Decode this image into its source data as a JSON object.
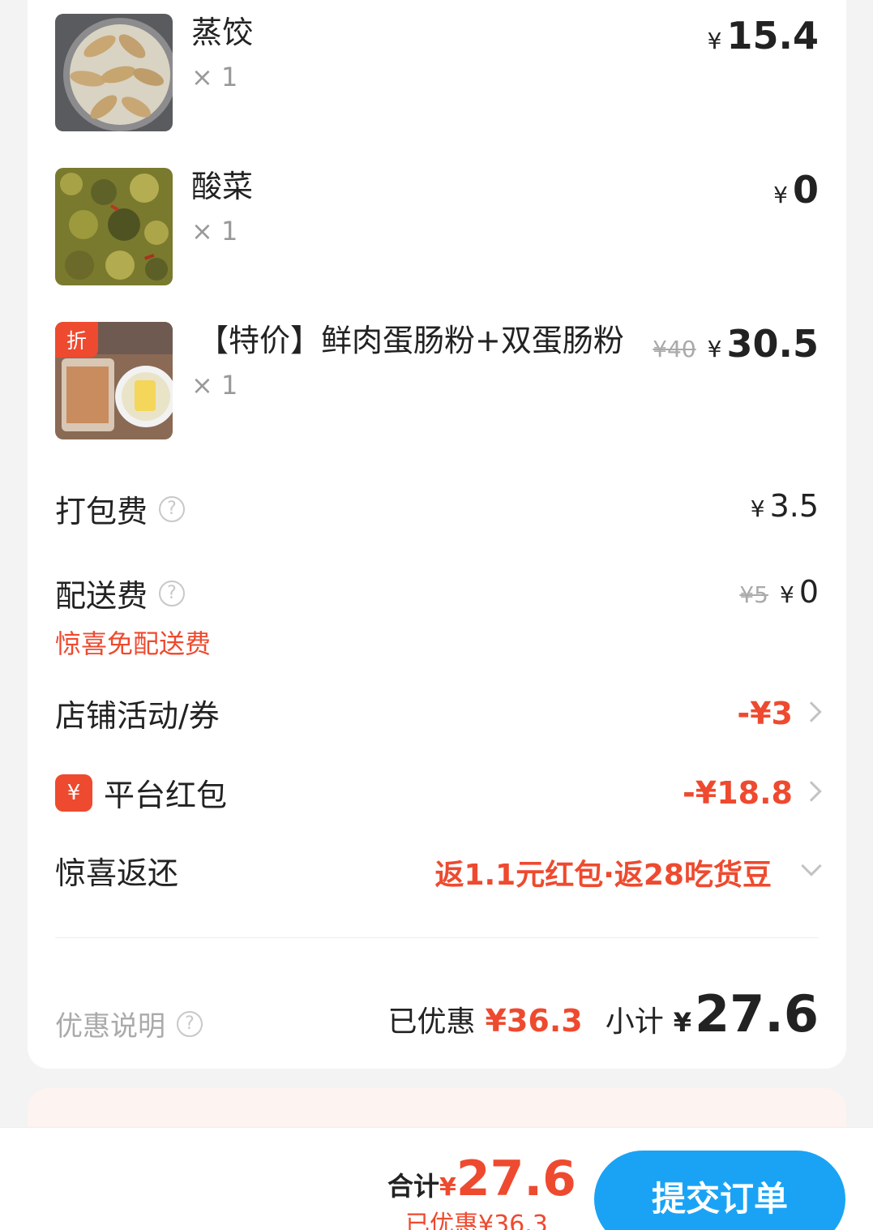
{
  "items": [
    {
      "name": "蒸饺",
      "qty": "× 1",
      "yen": "¥",
      "price": "15.4",
      "original_price": ""
    },
    {
      "name": "酸菜",
      "qty": "× 1",
      "yen": "¥",
      "price": "0",
      "original_price": ""
    },
    {
      "name": "【特价】鲜肉蛋肠粉+双蛋肠粉",
      "qty": "× 1",
      "yen": "¥",
      "price": "30.5",
      "original_price": "¥40",
      "tag": "折"
    }
  ],
  "packing_fee": {
    "label": "打包费",
    "yen": "¥",
    "value": "3.5"
  },
  "delivery_fee": {
    "label": "配送费",
    "original": "¥5",
    "yen": "¥",
    "value": "0",
    "note": "惊喜免配送费"
  },
  "store_coupon": {
    "label": "店铺活动/券",
    "value": "-¥3"
  },
  "platform_hongbao": {
    "label": "平台红包",
    "icon_text": "¥",
    "value": "-¥18.8"
  },
  "surprise_return": {
    "label": "惊喜返还",
    "value": "返1.1元红包·返28吃货豆"
  },
  "summary": {
    "discount_note": "优惠说明",
    "saved_label": "已优惠",
    "saved_value": "¥36.3",
    "subtotal_label": "小计",
    "subtotal_yen": "¥",
    "subtotal_value": "27.6"
  },
  "bottom_bar": {
    "total_label": "合计",
    "total_yen": "¥",
    "total_value": "27.6",
    "saved_text": "已优惠¥36.3",
    "submit_label": "提交订单"
  },
  "colors": {
    "accent": "#ee4a2f",
    "button": "#1aa3f5"
  },
  "icons": [
    "help-icon",
    "chevron-right-icon",
    "chevron-down-icon",
    "hongbao-icon"
  ]
}
